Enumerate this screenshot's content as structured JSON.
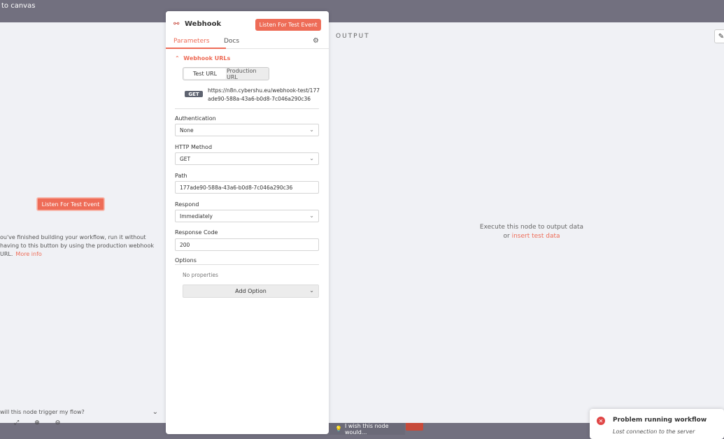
{
  "topbar": {
    "back_label": "to canvas"
  },
  "left": {
    "listen_label": "Listen For Test Event",
    "help_text": "ou've finished building your workflow, run it without having to this button by using the production webhook URL.",
    "help_link": "More info",
    "trigger_question": "will this node trigger my flow?"
  },
  "panel": {
    "title": "Webhook",
    "listen_label": "Listen For Test Event",
    "tabs": [
      "Parameters",
      "Docs"
    ],
    "section_title": "Webhook URLs",
    "url_toggle": [
      "Test URL",
      "Production URL"
    ],
    "method_badge": "GET",
    "webhook_url": "https://n8n.cybershu.eu/webhook-test/177ade90-588a-43a6-b0d8-7c046a290c36",
    "fields": [
      {
        "label": "Authentication",
        "value": "None"
      },
      {
        "label": "HTTP Method",
        "value": "GET"
      },
      {
        "label": "Path",
        "value": "177ade90-588a-43a6-b0d8-7c046a290c36"
      },
      {
        "label": "Respond",
        "value": "Immediately"
      },
      {
        "label": "Response Code",
        "value": "200"
      }
    ],
    "options_label": "Options",
    "no_properties": "No properties",
    "add_option": "Add Option"
  },
  "output": {
    "title": "OUTPUT",
    "message": "Execute this node to output data",
    "or_text": "or",
    "insert_link": "insert test data"
  },
  "feedback": {
    "label": "I wish this node would..."
  },
  "toast": {
    "title": "Problem running workflow",
    "message": "Lost connection to the server"
  },
  "colors": {
    "accent": "#ee6c57",
    "error": "#e04545"
  }
}
